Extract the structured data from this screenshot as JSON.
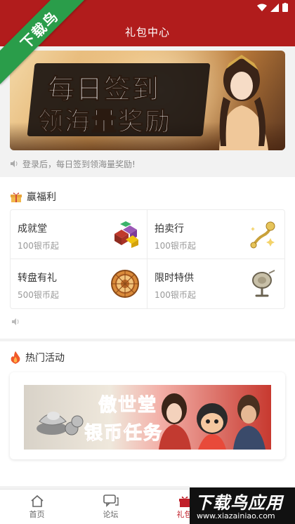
{
  "header": {
    "title": "礼包中心"
  },
  "corner_badge": "下载鸟",
  "banner": {
    "line1": "每日签到",
    "line2": "领海量奖励"
  },
  "notice": {
    "text": "登录后，每日签到领海量奖励!"
  },
  "welfare": {
    "title": "赢福利",
    "items": [
      {
        "name": "成就堂",
        "price": "100银币起",
        "icon": "gem-cubes-icon"
      },
      {
        "name": "拍卖行",
        "price": "100银币起",
        "icon": "ruyi-scepter-icon"
      },
      {
        "name": "转盘有礼",
        "price": "500银币起",
        "icon": "wheel-icon"
      },
      {
        "name": "限时特供",
        "price": "100银币起",
        "icon": "gong-icon"
      }
    ]
  },
  "hot": {
    "title": "热门活动",
    "banner_line1": "傲世堂",
    "banner_line2": "银币任务"
  },
  "nav": {
    "items": [
      {
        "label": "首页",
        "icon": "home-icon"
      },
      {
        "label": "论坛",
        "icon": "forum-icon"
      },
      {
        "label": "礼包",
        "icon": "gift-icon"
      }
    ]
  },
  "watermark": {
    "text": "下载鸟应用",
    "url": "www.xiazainiao.com"
  },
  "colors": {
    "header": "#b11c1c",
    "accent": "#c0202a",
    "ribbon": "#2a9d4a"
  }
}
